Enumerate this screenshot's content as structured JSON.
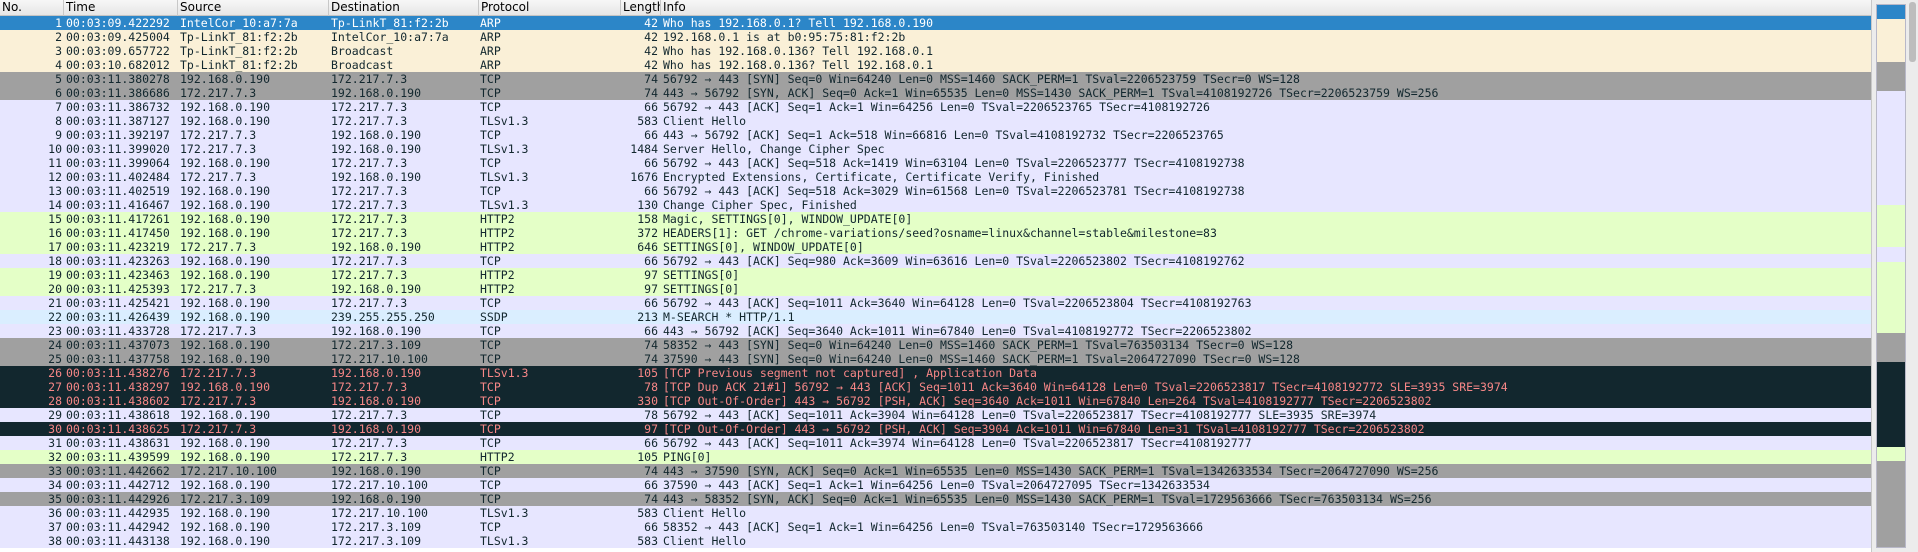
{
  "columns": [
    "No.",
    "Time",
    "Source",
    "Destination",
    "Protocol",
    "Length",
    "Info"
  ],
  "colors": {
    "selected": "#2c86c8",
    "arp": "#faf0d7",
    "tcp_syn": "#a0a0a0",
    "tcp": "#e7e6ff",
    "http": "#e4ffc7",
    "bad_tcp": "#12272e",
    "ssdp": "#daeeff"
  },
  "packets": [
    {
      "no": "1",
      "time": "00:03:09.422292",
      "src": "IntelCor_10:a7:7a",
      "dst": "Tp-LinkT_81:f2:2b",
      "proto": "ARP",
      "len": "42",
      "info": "Who has 192.168.0.1? Tell 192.168.0.190",
      "type": "sel"
    },
    {
      "no": "2",
      "time": "00:03:09.425004",
      "src": "Tp-LinkT_81:f2:2b",
      "dst": "IntelCor_10:a7:7a",
      "proto": "ARP",
      "len": "42",
      "info": "192.168.0.1 is at b0:95:75:81:f2:2b",
      "type": "arp"
    },
    {
      "no": "3",
      "time": "00:03:09.657722",
      "src": "Tp-LinkT_81:f2:2b",
      "dst": "Broadcast",
      "proto": "ARP",
      "len": "42",
      "info": "Who has 192.168.0.136? Tell 192.168.0.1",
      "type": "arp"
    },
    {
      "no": "4",
      "time": "00:03:10.682012",
      "src": "Tp-LinkT_81:f2:2b",
      "dst": "Broadcast",
      "proto": "ARP",
      "len": "42",
      "info": "Who has 192.168.0.136? Tell 192.168.0.1",
      "type": "arp"
    },
    {
      "no": "5",
      "time": "00:03:11.380278",
      "src": "192.168.0.190",
      "dst": "172.217.7.3",
      "proto": "TCP",
      "len": "74",
      "info": "56792 → 443 [SYN] Seq=0 Win=64240 Len=0 MSS=1460 SACK_PERM=1 TSval=2206523759 TSecr=0 WS=128",
      "type": "syn"
    },
    {
      "no": "6",
      "time": "00:03:11.386686",
      "src": "172.217.7.3",
      "dst": "192.168.0.190",
      "proto": "TCP",
      "len": "74",
      "info": "443 → 56792 [SYN, ACK] Seq=0 Ack=1 Win=65535 Len=0 MSS=1430 SACK_PERM=1 TSval=4108192726 TSecr=2206523759 WS=256",
      "type": "syn"
    },
    {
      "no": "7",
      "time": "00:03:11.386732",
      "src": "192.168.0.190",
      "dst": "172.217.7.3",
      "proto": "TCP",
      "len": "66",
      "info": "56792 → 443 [ACK] Seq=1 Ack=1 Win=64256 Len=0 TSval=2206523765 TSecr=4108192726",
      "type": "tcp"
    },
    {
      "no": "8",
      "time": "00:03:11.387127",
      "src": "192.168.0.190",
      "dst": "172.217.7.3",
      "proto": "TLSv1.3",
      "len": "583",
      "info": "Client Hello",
      "type": "tcp"
    },
    {
      "no": "9",
      "time": "00:03:11.392197",
      "src": "172.217.7.3",
      "dst": "192.168.0.190",
      "proto": "TCP",
      "len": "66",
      "info": "443 → 56792 [ACK] Seq=1 Ack=518 Win=66816 Len=0 TSval=4108192732 TSecr=2206523765",
      "type": "tcp"
    },
    {
      "no": "10",
      "time": "00:03:11.399020",
      "src": "172.217.7.3",
      "dst": "192.168.0.190",
      "proto": "TLSv1.3",
      "len": "1484",
      "info": "Server Hello, Change Cipher Spec",
      "type": "tcp"
    },
    {
      "no": "11",
      "time": "00:03:11.399064",
      "src": "192.168.0.190",
      "dst": "172.217.7.3",
      "proto": "TCP",
      "len": "66",
      "info": "56792 → 443 [ACK] Seq=518 Ack=1419 Win=63104 Len=0 TSval=2206523777 TSecr=4108192738",
      "type": "tcp"
    },
    {
      "no": "12",
      "time": "00:03:11.402484",
      "src": "172.217.7.3",
      "dst": "192.168.0.190",
      "proto": "TLSv1.3",
      "len": "1676",
      "info": "Encrypted Extensions, Certificate, Certificate Verify, Finished",
      "type": "tcp"
    },
    {
      "no": "13",
      "time": "00:03:11.402519",
      "src": "192.168.0.190",
      "dst": "172.217.7.3",
      "proto": "TCP",
      "len": "66",
      "info": "56792 → 443 [ACK] Seq=518 Ack=3029 Win=61568 Len=0 TSval=2206523781 TSecr=4108192738",
      "type": "tcp"
    },
    {
      "no": "14",
      "time": "00:03:11.416467",
      "src": "192.168.0.190",
      "dst": "172.217.7.3",
      "proto": "TLSv1.3",
      "len": "130",
      "info": "Change Cipher Spec, Finished",
      "type": "tcp"
    },
    {
      "no": "15",
      "time": "00:03:11.417261",
      "src": "192.168.0.190",
      "dst": "172.217.7.3",
      "proto": "HTTP2",
      "len": "158",
      "info": "Magic, SETTINGS[0], WINDOW_UPDATE[0]",
      "type": "http"
    },
    {
      "no": "16",
      "time": "00:03:11.417450",
      "src": "192.168.0.190",
      "dst": "172.217.7.3",
      "proto": "HTTP2",
      "len": "372",
      "info": "HEADERS[1]: GET /chrome-variations/seed?osname=linux&channel=stable&milestone=83",
      "type": "http"
    },
    {
      "no": "17",
      "time": "00:03:11.423219",
      "src": "172.217.7.3",
      "dst": "192.168.0.190",
      "proto": "HTTP2",
      "len": "646",
      "info": "SETTINGS[0], WINDOW_UPDATE[0]",
      "type": "http"
    },
    {
      "no": "18",
      "time": "00:03:11.423263",
      "src": "192.168.0.190",
      "dst": "172.217.7.3",
      "proto": "TCP",
      "len": "66",
      "info": "56792 → 443 [ACK] Seq=980 Ack=3609 Win=63616 Len=0 TSval=2206523802 TSecr=4108192762",
      "type": "tcp"
    },
    {
      "no": "19",
      "time": "00:03:11.423463",
      "src": "192.168.0.190",
      "dst": "172.217.7.3",
      "proto": "HTTP2",
      "len": "97",
      "info": "SETTINGS[0]",
      "type": "http"
    },
    {
      "no": "20",
      "time": "00:03:11.425393",
      "src": "172.217.7.3",
      "dst": "192.168.0.190",
      "proto": "HTTP2",
      "len": "97",
      "info": "SETTINGS[0]",
      "type": "http"
    },
    {
      "no": "21",
      "time": "00:03:11.425421",
      "src": "192.168.0.190",
      "dst": "172.217.7.3",
      "proto": "TCP",
      "len": "66",
      "info": "56792 → 443 [ACK] Seq=1011 Ack=3640 Win=64128 Len=0 TSval=2206523804 TSecr=4108192763",
      "type": "tcp"
    },
    {
      "no": "22",
      "time": "00:03:11.426439",
      "src": "192.168.0.190",
      "dst": "239.255.255.250",
      "proto": "SSDP",
      "len": "213",
      "info": "M-SEARCH * HTTP/1.1",
      "type": "ssdp"
    },
    {
      "no": "23",
      "time": "00:03:11.433728",
      "src": "172.217.7.3",
      "dst": "192.168.0.190",
      "proto": "TCP",
      "len": "66",
      "info": "443 → 56792 [ACK] Seq=3640 Ack=1011 Win=67840 Len=0 TSval=4108192772 TSecr=2206523802",
      "type": "tcp"
    },
    {
      "no": "24",
      "time": "00:03:11.437073",
      "src": "192.168.0.190",
      "dst": "172.217.3.109",
      "proto": "TCP",
      "len": "74",
      "info": "58352 → 443 [SYN] Seq=0 Win=64240 Len=0 MSS=1460 SACK_PERM=1 TSval=763503134 TSecr=0 WS=128",
      "type": "syn"
    },
    {
      "no": "25",
      "time": "00:03:11.437758",
      "src": "192.168.0.190",
      "dst": "172.217.10.100",
      "proto": "TCP",
      "len": "74",
      "info": "37590 → 443 [SYN] Seq=0 Win=64240 Len=0 MSS=1460 SACK_PERM=1 TSval=2064727090 TSecr=0 WS=128",
      "type": "syn"
    },
    {
      "no": "26",
      "time": "00:03:11.438276",
      "src": "172.217.7.3",
      "dst": "192.168.0.190",
      "proto": "TLSv1.3",
      "len": "105",
      "info": "[TCP Previous segment not captured] , Application Data",
      "type": "bad"
    },
    {
      "no": "27",
      "time": "00:03:11.438297",
      "src": "192.168.0.190",
      "dst": "172.217.7.3",
      "proto": "TCP",
      "len": "78",
      "info": "[TCP Dup ACK 21#1] 56792 → 443 [ACK] Seq=1011 Ack=3640 Win=64128 Len=0 TSval=2206523817 TSecr=4108192772 SLE=3935 SRE=3974",
      "type": "bad"
    },
    {
      "no": "28",
      "time": "00:03:11.438602",
      "src": "172.217.7.3",
      "dst": "192.168.0.190",
      "proto": "TCP",
      "len": "330",
      "info": "[TCP Out-Of-Order] 443 → 56792 [PSH, ACK] Seq=3640 Ack=1011 Win=67840 Len=264 TSval=4108192777 TSecr=2206523802",
      "type": "bad"
    },
    {
      "no": "29",
      "time": "00:03:11.438618",
      "src": "192.168.0.190",
      "dst": "172.217.7.3",
      "proto": "TCP",
      "len": "78",
      "info": "56792 → 443 [ACK] Seq=1011 Ack=3904 Win=64128 Len=0 TSval=2206523817 TSecr=4108192777 SLE=3935 SRE=3974",
      "type": "tcp"
    },
    {
      "no": "30",
      "time": "00:03:11.438625",
      "src": "172.217.7.3",
      "dst": "192.168.0.190",
      "proto": "TCP",
      "len": "97",
      "info": "[TCP Out-Of-Order] 443 → 56792 [PSH, ACK] Seq=3904 Ack=1011 Win=67840 Len=31 TSval=4108192777 TSecr=2206523802",
      "type": "bad"
    },
    {
      "no": "31",
      "time": "00:03:11.438631",
      "src": "192.168.0.190",
      "dst": "172.217.7.3",
      "proto": "TCP",
      "len": "66",
      "info": "56792 → 443 [ACK] Seq=1011 Ack=3974 Win=64128 Len=0 TSval=2206523817 TSecr=4108192777",
      "type": "tcp"
    },
    {
      "no": "32",
      "time": "00:03:11.439599",
      "src": "192.168.0.190",
      "dst": "172.217.7.3",
      "proto": "HTTP2",
      "len": "105",
      "info": "PING[0]",
      "type": "http"
    },
    {
      "no": "33",
      "time": "00:03:11.442662",
      "src": "172.217.10.100",
      "dst": "192.168.0.190",
      "proto": "TCP",
      "len": "74",
      "info": "443 → 37590 [SYN, ACK] Seq=0 Ack=1 Win=65535 Len=0 MSS=1430 SACK_PERM=1 TSval=1342633534 TSecr=2064727090 WS=256",
      "type": "syn"
    },
    {
      "no": "34",
      "time": "00:03:11.442712",
      "src": "192.168.0.190",
      "dst": "172.217.10.100",
      "proto": "TCP",
      "len": "66",
      "info": "37590 → 443 [ACK] Seq=1 Ack=1 Win=64256 Len=0 TSval=2064727095 TSecr=1342633534",
      "type": "tcp"
    },
    {
      "no": "35",
      "time": "00:03:11.442926",
      "src": "172.217.3.109",
      "dst": "192.168.0.190",
      "proto": "TCP",
      "len": "74",
      "info": "443 → 58352 [SYN, ACK] Seq=0 Ack=1 Win=65535 Len=0 MSS=1430 SACK_PERM=1 TSval=1729563666 TSecr=763503134 WS=256",
      "type": "syn"
    },
    {
      "no": "36",
      "time": "00:03:11.442935",
      "src": "192.168.0.190",
      "dst": "172.217.10.100",
      "proto": "TLSv1.3",
      "len": "583",
      "info": "Client Hello",
      "type": "tcp"
    },
    {
      "no": "37",
      "time": "00:03:11.442942",
      "src": "192.168.0.190",
      "dst": "172.217.3.109",
      "proto": "TCP",
      "len": "66",
      "info": "58352 → 443 [ACK] Seq=1 Ack=1 Win=64256 Len=0 TSval=763503140 TSecr=1729563666",
      "type": "tcp"
    },
    {
      "no": "38",
      "time": "00:03:11.443138",
      "src": "192.168.0.190",
      "dst": "172.217.3.109",
      "proto": "TLSv1.3",
      "len": "583",
      "info": "Client Hello",
      "type": "tcp"
    }
  ],
  "minimap_bands": [
    {
      "color": "#2c86c8",
      "t": 0
    },
    {
      "color": "#faf0d7",
      "t": 1
    },
    {
      "color": "#a0a0a0",
      "t": 4
    },
    {
      "color": "#e7e6ff",
      "t": 6
    },
    {
      "color": "#e4ffc7",
      "t": 14
    },
    {
      "color": "#e7e6ff",
      "t": 17
    },
    {
      "color": "#e4ffc7",
      "t": 18
    },
    {
      "color": "#a0a0a0",
      "t": 23
    },
    {
      "color": "#12272e",
      "t": 25
    },
    {
      "color": "#e4ffc7",
      "t": 31
    },
    {
      "color": "#a0a0a0",
      "t": 32
    }
  ]
}
